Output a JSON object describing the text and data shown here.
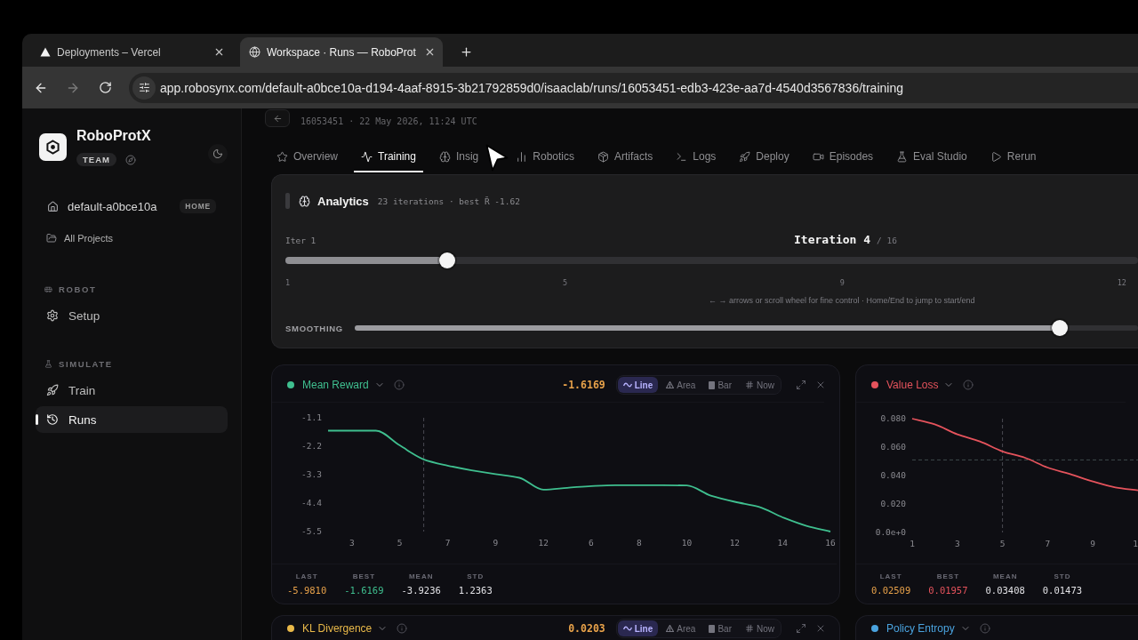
{
  "browser": {
    "tabs": [
      {
        "title": "Deployments – Vercel",
        "selected": false
      },
      {
        "title": "Workspace · Runs — RoboProt",
        "selected": true
      }
    ],
    "forward_disabled": true,
    "url": "app.robosynx.com/default-a0bce10a-d194-4aaf-8915-3b21792859d0/isaaclab/runs/16053451-edb3-423e-aa7d-4540d3567836/training"
  },
  "sidebar": {
    "brand": "RoboProtX",
    "plan": "TEAM",
    "project": {
      "label": "default-a0bce10a",
      "tag": "HOME"
    },
    "all_projects": "All Projects",
    "sections": [
      {
        "title": "ROBOT",
        "items": [
          {
            "label": "Setup",
            "selected": false
          }
        ]
      },
      {
        "title": "SIMULATE",
        "items": [
          {
            "label": "Train",
            "selected": false
          },
          {
            "label": "Runs",
            "selected": true
          }
        ]
      }
    ]
  },
  "run": {
    "meta": "16053451 · 22 May 2026, 11:24 UTC",
    "tabs": [
      {
        "label": "Overview",
        "selected": false
      },
      {
        "label": "Training",
        "selected": true
      },
      {
        "label": "Insig",
        "selected": false
      },
      {
        "label": "Robotics",
        "selected": false
      },
      {
        "label": "Artifacts",
        "selected": false
      },
      {
        "label": "Logs",
        "selected": false
      },
      {
        "label": "Deploy",
        "selected": false
      },
      {
        "label": "Episodes",
        "selected": false
      },
      {
        "label": "Eval Studio",
        "selected": false
      },
      {
        "label": "Rerun",
        "selected": false
      }
    ]
  },
  "analytics": {
    "title": "Analytics",
    "summary": "23 iterations · best R̄ -1.62",
    "start_label": "Iter 1",
    "iteration": "Iteration 4",
    "total": "/ 16",
    "level": 0.19,
    "ticks": [
      "1",
      "5",
      "9",
      "12"
    ],
    "hint": "← → arrows or scroll wheel for fine control · Home/End to jump to start/end",
    "smoothing": {
      "label": "SMOOTHING",
      "level": 0.9
    }
  },
  "cards": [
    {
      "title": "Mean Reward",
      "color": "#3fbf8f",
      "value": "-1.6169",
      "modes": [
        {
          "label": "Line",
          "selected": true
        },
        {
          "label": "Area",
          "selected": false
        },
        {
          "label": "Bar",
          "selected": false
        },
        {
          "label": "Now",
          "selected": false
        }
      ],
      "chart_data": {
        "type": "line",
        "categories": [
          null,
          "3",
          null,
          "5",
          null,
          "7",
          null,
          "9",
          null,
          "12",
          null,
          "6",
          null,
          "8",
          null,
          "10",
          null,
          "12",
          null,
          "14",
          null,
          "16"
        ],
        "values": [
          -1.6,
          -1.6,
          -1.6,
          -2.17,
          -2.71,
          -2.95,
          -3.13,
          -3.28,
          -3.42,
          -3.88,
          -3.81,
          -3.74,
          -3.71,
          -3.71,
          -3.71,
          -3.72,
          -4.11,
          -4.35,
          -4.54,
          -4.95,
          -5.28,
          -5.5
        ],
        "color": "#3fbf8f",
        "ylim": [
          -5.5,
          -1.1
        ],
        "yticks": [
          -1.1,
          -2.2,
          -3.3,
          -4.4,
          -5.5
        ]
      },
      "stats": [
        {
          "label": "LAST",
          "value": "-5.9810",
          "kind": "last"
        },
        {
          "label": "BEST",
          "value": "-1.6169",
          "kind": "best"
        },
        {
          "label": "MEAN",
          "value": "-3.9236",
          "kind": "plain"
        },
        {
          "label": "STD",
          "value": "1.2363",
          "kind": "plain"
        }
      ]
    },
    {
      "title": "Value Loss",
      "color": "#e5535c",
      "chart_data": {
        "type": "line",
        "categories": [
          "1",
          null,
          "3",
          null,
          "5",
          null,
          "7",
          null,
          "9",
          null,
          "1"
        ],
        "values": [
          0.08,
          0.076,
          0.069,
          0.064,
          0.057,
          0.0525,
          0.0456,
          0.041,
          0.0358,
          0.0317,
          0.0296
        ],
        "color": "#e5535c",
        "ylim": [
          0,
          0.08
        ],
        "yticks": [
          {
            "value": 0.08,
            "label": "0.080"
          },
          {
            "value": 0.06,
            "label": "0.060"
          },
          {
            "value": 0.04,
            "label": "0.040"
          },
          {
            "value": 0.02,
            "label": "0.020"
          },
          {
            "value": 0,
            "label": "0.0e+0"
          }
        ],
        "ref_lines": [
          {
            "axis": "x",
            "value": "5",
            "line_style": "dashed"
          },
          {
            "axis": "y",
            "value": 0.051,
            "line_style": "dashed"
          }
        ]
      },
      "stats": [
        {
          "label": "LAST",
          "value": "0.02509",
          "kind": "last"
        },
        {
          "label": "BEST",
          "value": "0.01957",
          "kind": "best"
        },
        {
          "label": "MEAN",
          "value": "0.03408",
          "kind": "plain"
        },
        {
          "label": "STD",
          "value": "0.01473",
          "kind": "plain"
        }
      ]
    },
    {
      "title": "KL Divergence",
      "color": "#e9b949",
      "value": "0.0203",
      "modes": [
        {
          "label": "Line",
          "selected": true
        },
        {
          "label": "Area",
          "selected": false
        },
        {
          "label": "Bar",
          "selected": false
        },
        {
          "label": "Now",
          "selected": false
        }
      ]
    },
    {
      "title": "Policy Entropy",
      "color": "#4aa3df"
    }
  ]
}
